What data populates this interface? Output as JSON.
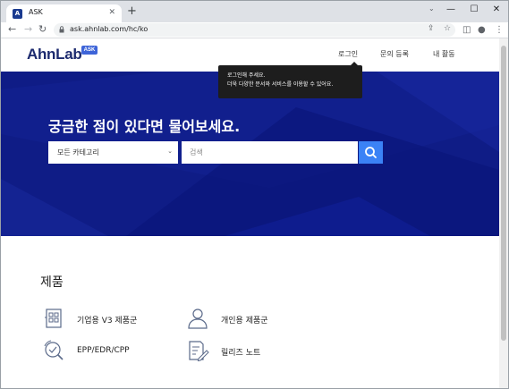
{
  "browser": {
    "tab_title": "ASK",
    "tab_favicon_text": "A",
    "tab_close": "✕",
    "new_tab": "+",
    "window_controls": {
      "minimize": "—",
      "maximize": "☐",
      "close": "✕"
    },
    "url": "ask.ahnlab.com/hc/ko",
    "nav": {
      "back": "←",
      "forward": "→",
      "reload": "↻"
    }
  },
  "site": {
    "logo": "AhnLab",
    "logo_badge": "ASK",
    "nav": {
      "login": "로그인",
      "submit_request": "문의 등록",
      "my_activity": "내 활동"
    },
    "tooltip": {
      "line1": "로그인해 주세요.",
      "line2": "더욱 다양한 문서와 서비스를 이용할 수 있어요."
    }
  },
  "hero": {
    "title": "궁금한 점이 있다면 물어보세요.",
    "category_selected": "모든 카테고리",
    "search_placeholder": "검색",
    "colors": {
      "background": "#0f1c86",
      "search_button": "#3b82f6"
    }
  },
  "products": {
    "title": "제품",
    "items": [
      {
        "label": "기업용 V3 제품군",
        "icon": "building-grid-icon"
      },
      {
        "label": "개인용 제품군",
        "icon": "person-icon"
      },
      {
        "label": "EPP/EDR/CPP",
        "icon": "shield-search-icon"
      },
      {
        "label": "릴리즈 노트",
        "icon": "document-pen-icon"
      }
    ]
  }
}
